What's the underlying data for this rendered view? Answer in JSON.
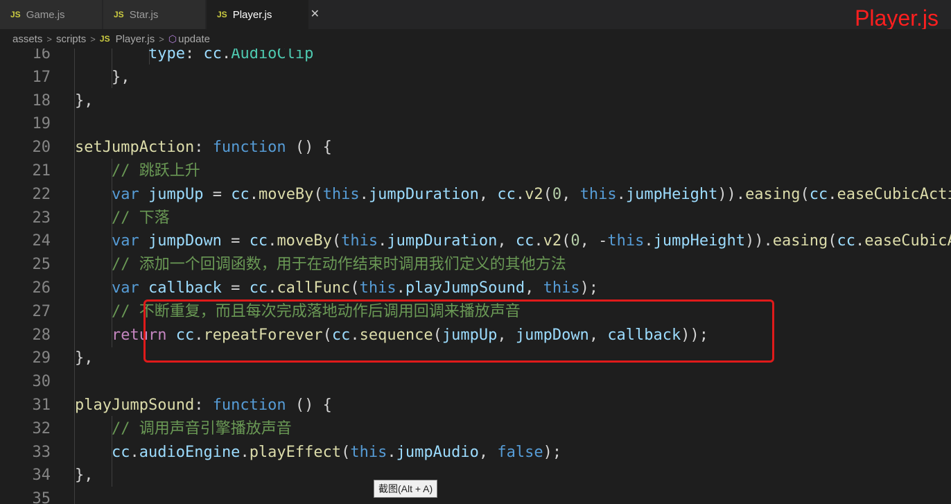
{
  "tabs": [
    {
      "icon": "JS",
      "label": "Game.js"
    },
    {
      "icon": "JS",
      "label": "Star.js"
    },
    {
      "icon": "JS",
      "label": "Player.js",
      "close": "✕"
    }
  ],
  "corner_label": "Player.js",
  "breadcrumb": {
    "parts": [
      "assets",
      "scripts"
    ],
    "file_icon": "JS",
    "file": "Player.js",
    "symbol_icon": "⬡",
    "symbol": "update"
  },
  "code_lines": [
    {
      "n": "16",
      "tokens": [
        [
          "pn",
          "        "
        ],
        [
          "vr",
          "type"
        ],
        [
          "pn",
          ": "
        ],
        [
          "vr",
          "cc"
        ],
        [
          "pn",
          "."
        ],
        [
          "ty",
          "AudioClip"
        ]
      ]
    },
    {
      "n": "17",
      "tokens": [
        [
          "pn",
          "    },"
        ]
      ]
    },
    {
      "n": "18",
      "tokens": [
        [
          "pn",
          "},"
        ]
      ]
    },
    {
      "n": "19",
      "tokens": []
    },
    {
      "n": "20",
      "tokens": [
        [
          "fn",
          "setJumpAction"
        ],
        [
          "pn",
          ": "
        ],
        [
          "kw",
          "function"
        ],
        [
          "pn",
          " () {"
        ]
      ]
    },
    {
      "n": "21",
      "tokens": [
        [
          "cm",
          "    // 跳跃上升"
        ]
      ]
    },
    {
      "n": "22",
      "tokens": [
        [
          "kw",
          "    var "
        ],
        [
          "vr",
          "jumpUp"
        ],
        [
          "pn",
          " = "
        ],
        [
          "vr",
          "cc"
        ],
        [
          "pn",
          "."
        ],
        [
          "fn",
          "moveBy"
        ],
        [
          "pn",
          "("
        ],
        [
          "kw",
          "this"
        ],
        [
          "pn",
          "."
        ],
        [
          "vr",
          "jumpDuration"
        ],
        [
          "pn",
          ", "
        ],
        [
          "vr",
          "cc"
        ],
        [
          "pn",
          "."
        ],
        [
          "fn",
          "v2"
        ],
        [
          "pn",
          "("
        ],
        [
          "nm",
          "0"
        ],
        [
          "pn",
          ", "
        ],
        [
          "kw",
          "this"
        ],
        [
          "pn",
          "."
        ],
        [
          "vr",
          "jumpHeight"
        ],
        [
          "pn",
          "))."
        ],
        [
          "fn",
          "easing"
        ],
        [
          "pn",
          "("
        ],
        [
          "vr",
          "cc"
        ],
        [
          "pn",
          "."
        ],
        [
          "fn",
          "easeCubicActionOut"
        ],
        [
          "pn",
          "());"
        ]
      ]
    },
    {
      "n": "23",
      "tokens": [
        [
          "cm",
          "    // 下落"
        ]
      ]
    },
    {
      "n": "24",
      "tokens": [
        [
          "kw",
          "    var "
        ],
        [
          "vr",
          "jumpDown"
        ],
        [
          "pn",
          " = "
        ],
        [
          "vr",
          "cc"
        ],
        [
          "pn",
          "."
        ],
        [
          "fn",
          "moveBy"
        ],
        [
          "pn",
          "("
        ],
        [
          "kw",
          "this"
        ],
        [
          "pn",
          "."
        ],
        [
          "vr",
          "jumpDuration"
        ],
        [
          "pn",
          ", "
        ],
        [
          "vr",
          "cc"
        ],
        [
          "pn",
          "."
        ],
        [
          "fn",
          "v2"
        ],
        [
          "pn",
          "("
        ],
        [
          "nm",
          "0"
        ],
        [
          "pn",
          ", -"
        ],
        [
          "kw",
          "this"
        ],
        [
          "pn",
          "."
        ],
        [
          "vr",
          "jumpHeight"
        ],
        [
          "pn",
          "))."
        ],
        [
          "fn",
          "easing"
        ],
        [
          "pn",
          "("
        ],
        [
          "vr",
          "cc"
        ],
        [
          "pn",
          "."
        ],
        [
          "fn",
          "easeCubicActionIn"
        ],
        [
          "pn",
          "());"
        ]
      ]
    },
    {
      "n": "25",
      "tokens": [
        [
          "cm",
          "    // 添加一个回调函数，用于在动作结束时调用我们定义的其他方法"
        ]
      ]
    },
    {
      "n": "26",
      "tokens": [
        [
          "kw",
          "    var "
        ],
        [
          "vr",
          "callback"
        ],
        [
          "pn",
          " = "
        ],
        [
          "vr",
          "cc"
        ],
        [
          "pn",
          "."
        ],
        [
          "fn",
          "callFunc"
        ],
        [
          "pn",
          "("
        ],
        [
          "kw",
          "this"
        ],
        [
          "pn",
          "."
        ],
        [
          "vr",
          "playJumpSound"
        ],
        [
          "pn",
          ", "
        ],
        [
          "kw",
          "this"
        ],
        [
          "pn",
          ");"
        ]
      ]
    },
    {
      "n": "27",
      "tokens": [
        [
          "cm",
          "    // 不断重复，而且每次完成落地动作后调用回调来播放声音"
        ]
      ]
    },
    {
      "n": "28",
      "tokens": [
        [
          "cf",
          "    return "
        ],
        [
          "vr",
          "cc"
        ],
        [
          "pn",
          "."
        ],
        [
          "fn",
          "repeatForever"
        ],
        [
          "pn",
          "("
        ],
        [
          "vr",
          "cc"
        ],
        [
          "pn",
          "."
        ],
        [
          "fn",
          "sequence"
        ],
        [
          "pn",
          "("
        ],
        [
          "vr",
          "jumpUp"
        ],
        [
          "pn",
          ", "
        ],
        [
          "vr",
          "jumpDown"
        ],
        [
          "pn",
          ", "
        ],
        [
          "vr",
          "callback"
        ],
        [
          "pn",
          "));"
        ]
      ]
    },
    {
      "n": "29",
      "tokens": [
        [
          "pn",
          "},"
        ]
      ]
    },
    {
      "n": "30",
      "tokens": []
    },
    {
      "n": "31",
      "tokens": [
        [
          "fn",
          "playJumpSound"
        ],
        [
          "pn",
          ": "
        ],
        [
          "kw",
          "function"
        ],
        [
          "pn",
          " () {"
        ]
      ]
    },
    {
      "n": "32",
      "tokens": [
        [
          "cm",
          "    // 调用声音引擎播放声音"
        ]
      ]
    },
    {
      "n": "33",
      "tokens": [
        [
          "vr",
          "    cc"
        ],
        [
          "pn",
          "."
        ],
        [
          "vr",
          "audioEngine"
        ],
        [
          "pn",
          "."
        ],
        [
          "fn",
          "playEffect"
        ],
        [
          "pn",
          "("
        ],
        [
          "kw",
          "this"
        ],
        [
          "pn",
          "."
        ],
        [
          "vr",
          "jumpAudio"
        ],
        [
          "pn",
          ", "
        ],
        [
          "kw",
          "false"
        ],
        [
          "pn",
          ");"
        ]
      ]
    },
    {
      "n": "34",
      "tokens": [
        [
          "pn",
          "},"
        ]
      ]
    },
    {
      "n": "35",
      "tokens": []
    }
  ],
  "tooltip": "截图(Alt + A)",
  "colors": {
    "keyword": "#569cd6",
    "function": "#dcdcaa",
    "variable": "#9cdcfe",
    "type": "#4ec9b0",
    "number": "#b5cea8",
    "comment": "#6a9955",
    "control": "#c586c0",
    "highlight": "#e01a1a"
  }
}
